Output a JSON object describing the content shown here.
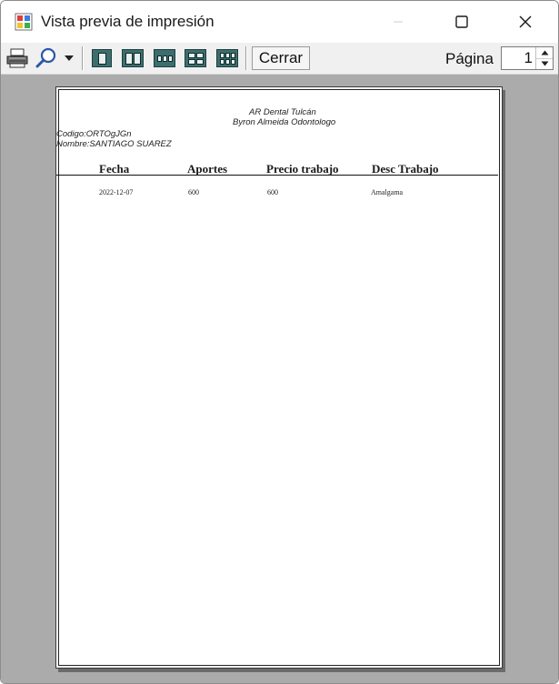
{
  "window": {
    "title": "Vista previa de impresión"
  },
  "toolbar": {
    "icons": [
      "printer-icon",
      "zoom-icon",
      "dropdown-arrow-icon",
      "one-page-icon",
      "two-pages-icon",
      "three-pages-icon",
      "four-pages-icon",
      "six-pages-icon"
    ],
    "close_label": "Cerrar",
    "page_label": "Página",
    "page_value": "1"
  },
  "document": {
    "title_line1": "AR Dental Tulcán",
    "title_line2": "Byron Almeida Odontologo",
    "codigo": "Codigo:ORTOgJGn",
    "nombre": "Nombre:SANTIAGO  SUAREZ",
    "columns": [
      "Fecha",
      "Aportes",
      "Precio trabajo",
      "Desc Trabajo"
    ],
    "rows": [
      [
        "2022-12-07",
        "600",
        "600",
        "Amalgama"
      ]
    ]
  },
  "colors": {
    "preview_background": "#ababab",
    "toolbar_background": "#f0f0f0",
    "layout_button_teal": "#3d6e6e"
  }
}
